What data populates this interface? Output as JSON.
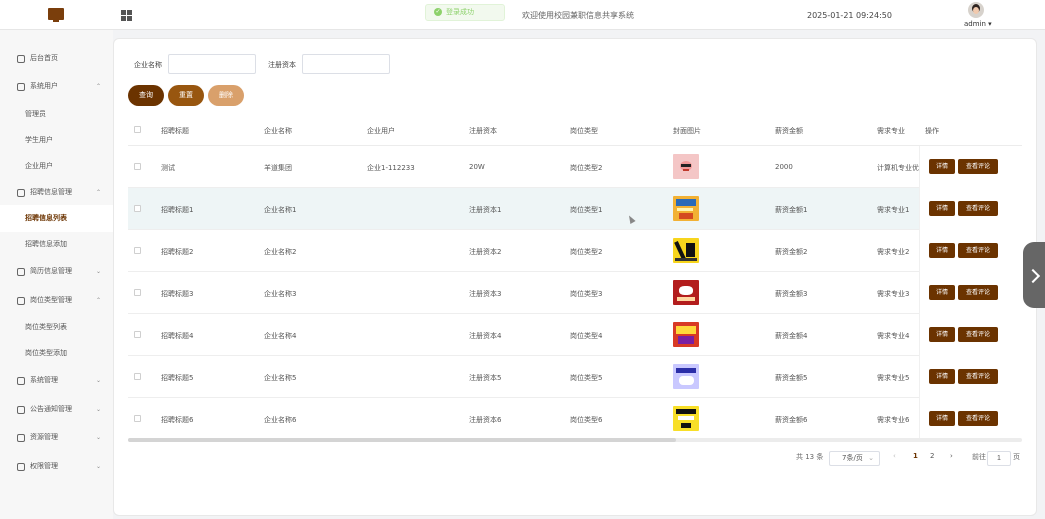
{
  "header": {
    "toast": "登录成功",
    "welcome": "欢迎使用校园兼职信息共享系统",
    "datetime": "2025-01-21 09:24:50",
    "user": "admin ▾"
  },
  "sidebar": {
    "items": [
      {
        "label": "后台首页",
        "icon": "clock-icon",
        "chevron": ""
      },
      {
        "label": "系统用户",
        "icon": "user-icon",
        "chevron": "⌃"
      },
      {
        "label": "管理员",
        "icon": "",
        "chevron": ""
      },
      {
        "label": "学生用户",
        "icon": "",
        "chevron": ""
      },
      {
        "label": "企业用户",
        "icon": "",
        "chevron": ""
      },
      {
        "label": "招聘信息管理",
        "icon": "calendar-icon",
        "chevron": "⌃"
      },
      {
        "label": "招聘信息列表",
        "icon": "",
        "chevron": "",
        "active": true
      },
      {
        "label": "招聘信息添加",
        "icon": "",
        "chevron": ""
      },
      {
        "label": "简历信息管理",
        "icon": "document-icon",
        "chevron": "⌄"
      },
      {
        "label": "岗位类型管理",
        "icon": "folder-icon",
        "chevron": "⌃"
      },
      {
        "label": "岗位类型列表",
        "icon": "",
        "chevron": ""
      },
      {
        "label": "岗位类型添加",
        "icon": "",
        "chevron": ""
      },
      {
        "label": "系统管理",
        "icon": "settings-icon",
        "chevron": "⌄"
      },
      {
        "label": "公告通知管理",
        "icon": "bell-icon",
        "chevron": "⌄"
      },
      {
        "label": "资源管理",
        "icon": "image-icon",
        "chevron": "⌄"
      },
      {
        "label": "权限管理",
        "icon": "shield-icon",
        "chevron": "⌄"
      }
    ]
  },
  "search": {
    "company_label": "企业名称",
    "capital_label": "注册资本",
    "company_value": "",
    "capital_value": "",
    "query": "查询",
    "reset": "重置",
    "delete": "删除"
  },
  "table": {
    "headers": [
      "招聘标题",
      "企业名称",
      "企业用户",
      "注册资本",
      "岗位类型",
      "封面图片",
      "薪资金额",
      "需求专业",
      "操作"
    ],
    "rows": [
      [
        "测试",
        "羊道集团",
        "企业1-112233",
        "20W",
        "岗位类型2",
        "",
        "2000",
        "计算机专业优"
      ],
      [
        "招聘标题1",
        "企业名称1",
        "",
        "注册资本1",
        "岗位类型1",
        "",
        "薪资金额1",
        "需求专业1"
      ],
      [
        "招聘标题2",
        "企业名称2",
        "",
        "注册资本2",
        "岗位类型2",
        "",
        "薪资金额2",
        "需求专业2"
      ],
      [
        "招聘标题3",
        "企业名称3",
        "",
        "注册资本3",
        "岗位类型3",
        "",
        "薪资金额3",
        "需求专业3"
      ],
      [
        "招聘标题4",
        "企业名称4",
        "",
        "注册资本4",
        "岗位类型4",
        "",
        "薪资金额4",
        "需求专业4"
      ],
      [
        "招聘标题5",
        "企业名称5",
        "",
        "注册资本5",
        "岗位类型5",
        "",
        "薪资金额5",
        "需求专业5"
      ],
      [
        "招聘标题6",
        "企业名称6",
        "",
        "注册资本6",
        "岗位类型6",
        "",
        "薪资金额6",
        "需求专业6"
      ]
    ],
    "detail_label": "详情",
    "comment_label": "查看评论"
  },
  "pagination": {
    "total": "共 13 条",
    "page_size": "7条/页",
    "prev": "‹",
    "pages": [
      "1",
      "2"
    ],
    "next": "›",
    "goto_label": "前往",
    "goto_value": "1",
    "page_unit": "页"
  },
  "colors": {
    "accent": "#6b3300",
    "reset": "#98560f",
    "delete": "#d9a06b"
  }
}
